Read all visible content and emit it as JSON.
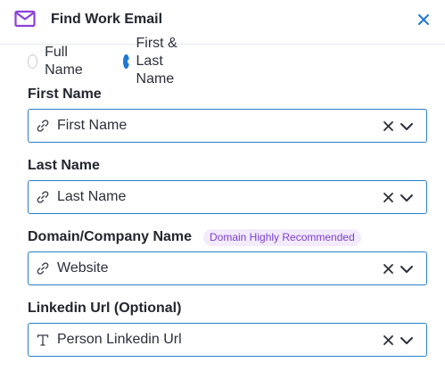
{
  "header": {
    "title": "Find Work Email",
    "icon": "mail-icon",
    "close_icon": "close-icon",
    "accent_color": "#8b3fd9"
  },
  "name_mode": {
    "options": [
      {
        "label": "Full Name",
        "selected": false
      },
      {
        "label": "First & Last Name",
        "selected": true
      }
    ]
  },
  "fields": [
    {
      "label": "First Name",
      "value": "First Name",
      "icon": "link-icon"
    },
    {
      "label": "Last Name",
      "value": "Last Name",
      "icon": "link-icon"
    },
    {
      "label": "Domain/Company Name",
      "badge": "Domain Highly Recommended",
      "value": "Website",
      "icon": "link-icon"
    },
    {
      "label": "Linkedin Url (Optional)",
      "value": "Person Linkedin Url",
      "icon": "text-icon"
    }
  ],
  "colors": {
    "field_border": "#2a7fc6",
    "radio_selected": "#1f78d1",
    "badge_bg": "#f3ebfc",
    "badge_text": "#7b3fd0"
  }
}
